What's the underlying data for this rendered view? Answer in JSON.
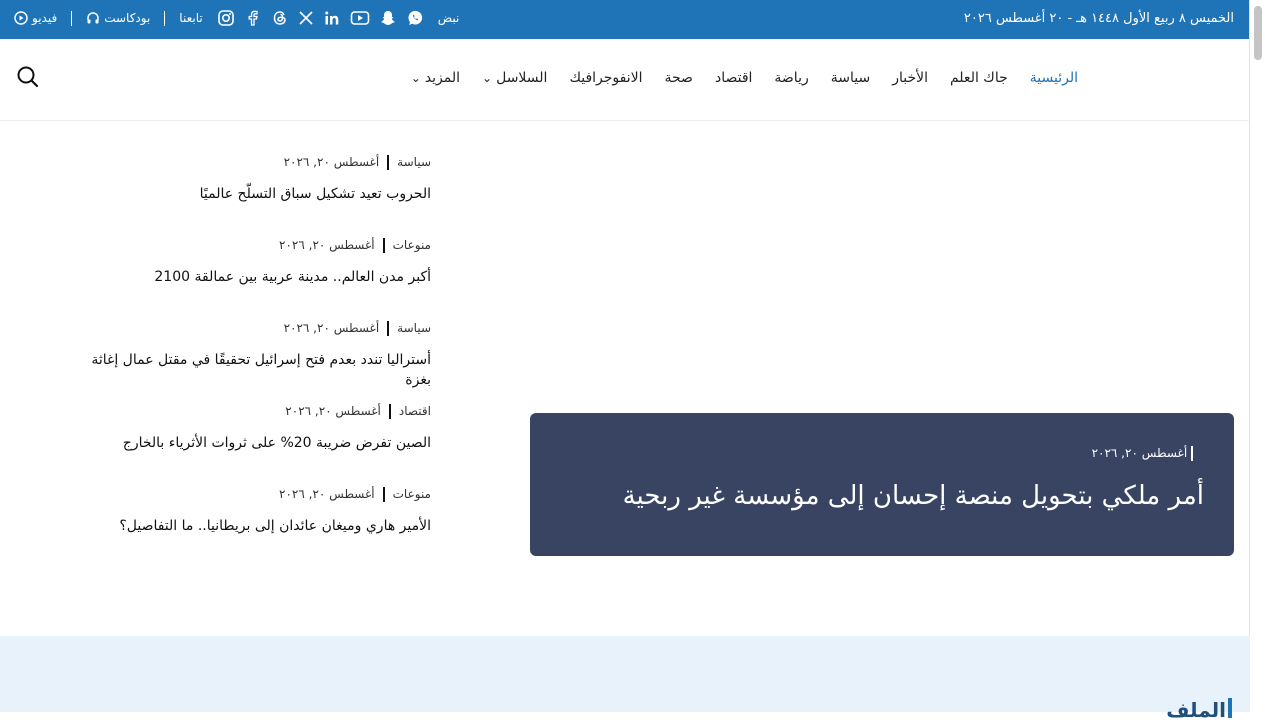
{
  "topbar": {
    "date": "الخميس ٨ ربيع الأول ١٤٤٨ هـ - ٢٠ أغسطس ٢٠٢٦",
    "video_label": "فيديو",
    "podcast_label": "بودكاست",
    "follow_label": "تابعنا",
    "pulse_label": "نبض",
    "social_icons": [
      "instagram-icon",
      "facebook-icon",
      "threads-icon",
      "x-icon",
      "linkedin-icon",
      "youtube-icon",
      "snapchat-icon",
      "whatsapp-icon"
    ]
  },
  "nav": {
    "items": [
      {
        "label": "الرئيسية",
        "active": true
      },
      {
        "label": "جاك العلم"
      },
      {
        "label": "الأخبار"
      },
      {
        "label": "سياسة"
      },
      {
        "label": "رياضة"
      },
      {
        "label": "اقتصاد"
      },
      {
        "label": "صحة"
      },
      {
        "label": "الانفوجرافيك"
      },
      {
        "label": "السلاسل",
        "dropdown": true
      },
      {
        "label": "المزيد",
        "dropdown": true
      }
    ]
  },
  "articles": [
    {
      "category": "سياسة",
      "date": "أغسطس ٢٠, ٢٠٢٦",
      "title": "الحروب تعيد تشكيل سباق التسلّح عالميًا"
    },
    {
      "category": "منوعات",
      "date": "أغسطس ٢٠, ٢٠٢٦",
      "title": "أكبر مدن العالم.. مدينة عربية بين عمالقة 2100"
    },
    {
      "category": "سياسة",
      "date": "أغسطس ٢٠, ٢٠٢٦",
      "title": "أستراليا تندد بعدم فتح إسرائيل تحقيقًا في مقتل عمال إغاثة بغزة"
    },
    {
      "category": "اقتصاد",
      "date": "أغسطس ٢٠, ٢٠٢٦",
      "title": "الصين تفرض ضريبة 20% على ثروات الأثرياء بالخارج"
    },
    {
      "category": "منوعات",
      "date": "أغسطس ٢٠, ٢٠٢٦",
      "title": "الأمير هاري وميغان عائدان إلى بريطانيا.. ما التفاصيل؟"
    }
  ],
  "hero": {
    "date": "أغسطس ٢٠, ٢٠٢٦",
    "title": "أمر ملكي بتحويل منصة إحسان إلى مؤسسة غير ربحية"
  },
  "bottom_section": {
    "partial_title": "الملف"
  },
  "colors": {
    "brand": "#1f73b7",
    "hero_bg": "#394463",
    "section_bg": "#e7f2fb"
  }
}
